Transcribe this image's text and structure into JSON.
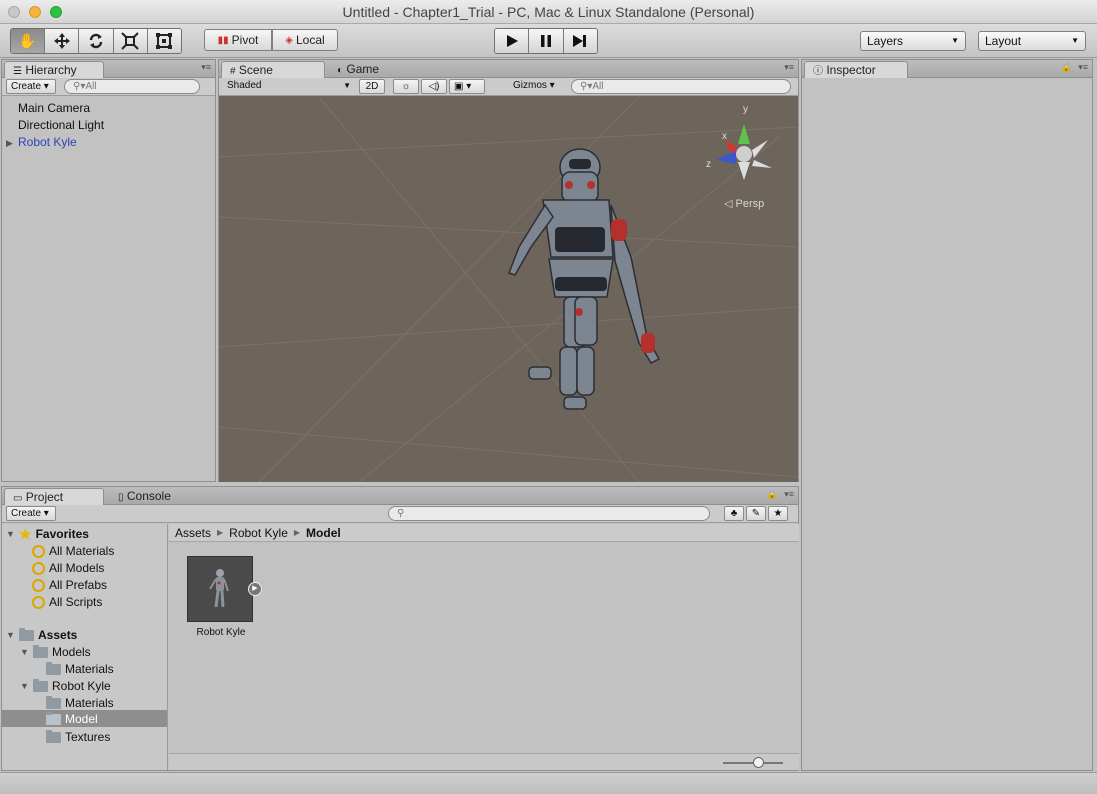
{
  "window": {
    "title": "Untitled - Chapter1_Trial - PC, Mac & Linux Standalone (Personal)"
  },
  "toolbar": {
    "tools": [
      "hand-icon",
      "move-icon",
      "rotate-icon",
      "scale-icon",
      "rect-icon"
    ],
    "pivot_label": "Pivot",
    "local_label": "Local",
    "layers_label": "Layers",
    "layout_label": "Layout"
  },
  "hierarchy": {
    "tab": "Hierarchy",
    "create": "Create",
    "search_placeholder": "All",
    "items": [
      "Main Camera",
      "Directional Light",
      "Robot Kyle"
    ]
  },
  "scene": {
    "tab_scene": "Scene",
    "tab_game": "Game",
    "shading": "Shaded",
    "mode_2d": "2D",
    "gizmos": "Gizmos",
    "search_placeholder": "All",
    "persp_label": "Persp",
    "axis_labels": {
      "y": "y",
      "x": "x",
      "z": "z"
    },
    "colors": {
      "background": "#6d645c",
      "robot_body": "#7d8590",
      "robot_accent": "#b4302c"
    }
  },
  "inspector": {
    "tab": "Inspector"
  },
  "project": {
    "tab_project": "Project",
    "tab_console": "Console",
    "create": "Create",
    "favorites_label": "Favorites",
    "favorites": [
      "All Materials",
      "All Models",
      "All Prefabs",
      "All Scripts"
    ],
    "assets_label": "Assets",
    "folders": {
      "models": "Models",
      "models_materials": "Materials",
      "robot_kyle": "Robot Kyle",
      "rk_materials": "Materials",
      "rk_model": "Model",
      "rk_textures": "Textures"
    },
    "breadcrumb": [
      "Assets",
      "Robot Kyle",
      "Model"
    ],
    "asset_name": "Robot Kyle",
    "zoom_level": 0.6
  }
}
